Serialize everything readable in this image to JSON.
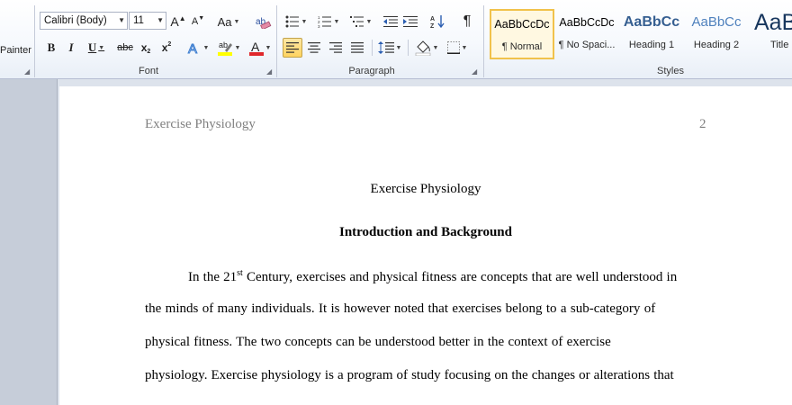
{
  "ribbon": {
    "clipboard": {
      "painter_label": "Painter"
    },
    "font": {
      "label": "Font",
      "font_name": "Calibri (Body)",
      "font_size": "11",
      "buttons": {
        "grow": "A",
        "shrink": "A",
        "change_case": "Aa",
        "bold": "B",
        "italic": "I",
        "underline": "U",
        "strike": "abc",
        "subscript": "x",
        "superscript": "x"
      }
    },
    "paragraph": {
      "label": "Paragraph",
      "pilcrow": "¶"
    },
    "styles": {
      "label": "Styles",
      "items": [
        {
          "sample": "AaBbCcDc",
          "name": "¶ Normal"
        },
        {
          "sample": "AaBbCcDc",
          "name": "¶ No Spaci..."
        },
        {
          "sample": "AaBbCc",
          "name": "Heading 1"
        },
        {
          "sample": "AaBbCc",
          "name": "Heading 2"
        },
        {
          "sample": "AaB",
          "name": "Title"
        }
      ]
    }
  },
  "document": {
    "header": {
      "title": "Exercise Physiology",
      "page_number": "2"
    },
    "title": "Exercise Physiology",
    "heading": "Introduction and Background",
    "lines": [
      {
        "before": "In the 21",
        "sup": "st",
        "after": " Century, exercises and physical fitness are concepts that are well understood in"
      },
      {
        "text": "the minds of many individuals. It is however noted that exercises belong to a sub-category of"
      },
      {
        "text": "physical fitness. The two concepts can be understood better in the context of exercise"
      },
      {
        "text": "physiology. Exercise physiology is a program of study focusing on the changes or alterations that"
      }
    ]
  }
}
